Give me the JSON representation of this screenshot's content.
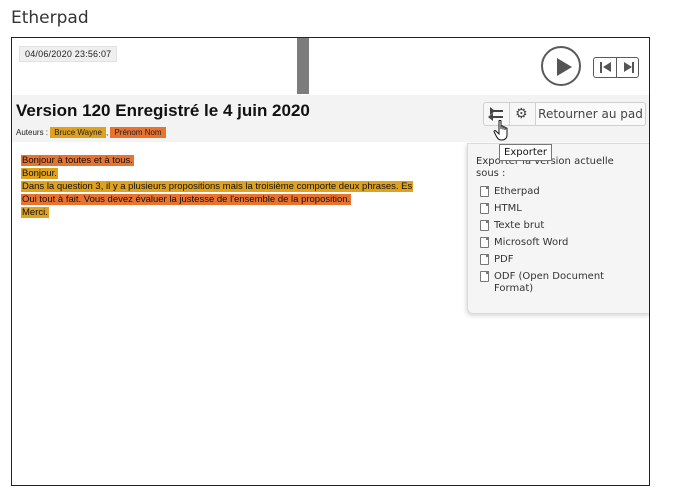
{
  "page": {
    "heading": "Etherpad"
  },
  "timeslider": {
    "timestamp": "04/06/2020 23:56:07"
  },
  "revision": {
    "title": "Version 120 Enregistré le 4 juin 2020",
    "authors_label": "Auteurs :",
    "authors": [
      "Bruce Wayne",
      "Prénom Nom"
    ],
    "authors_separator": ","
  },
  "toolbar": {
    "return_label": "Retourner au pad",
    "export_tooltip": "Exporter"
  },
  "document": {
    "lines": [
      "Bonjour à toutes et à tous.",
      "Bonjour.",
      "Dans la question 3, il y a plusieurs propositions mais la troisième comporte deux phrases. Es",
      "Oui tout à fait. Vous devez évaluer la justesse de l'ensemble de la proposition.",
      "Merci."
    ]
  },
  "export_panel": {
    "intro": "Exporter la version actuelle sous :",
    "items": [
      "Etherpad",
      "HTML",
      "Texte brut",
      "Microsoft Word",
      "PDF",
      "ODF (Open Document Format)"
    ]
  },
  "colors": {
    "author_1": "#e0a21c",
    "author_2": "#e8732f"
  }
}
